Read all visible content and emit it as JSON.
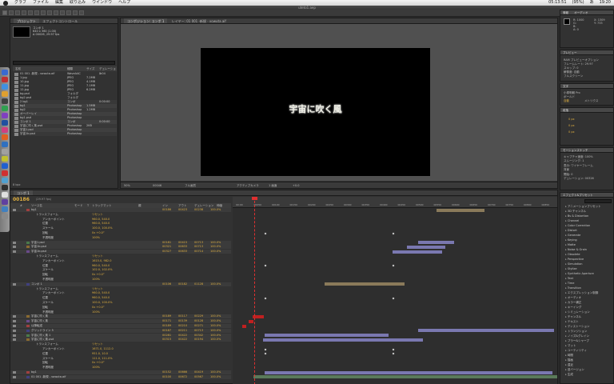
{
  "menubar": {
    "items": [
      "グラフ",
      "ファイル",
      "編集",
      "取り込み",
      "ウインドウ",
      "ヘルプ"
    ],
    "right": [
      "05:13:51",
      "(95%)",
      "あ",
      "19:20"
    ]
  },
  "window_title": "uteto1.aep",
  "toolbar": {
    "workspace": "ワークスペース"
  },
  "project_panel": {
    "tab": "プロジェクト",
    "tab2": "エフェクトコントロール",
    "thumb_info": [
      "コンポ 1",
      "640 x 360 (1.00)",
      "Δ 00026, 29.97 fps"
    ],
    "headers": [
      "名前",
      "種類",
      "サイズ",
      "デュレーション"
    ],
    "rows": [
      {
        "name": "01 001 -新規 - vowuta.aif",
        "type": "WaveAAC",
        "size": "",
        "dur": "0:04"
      },
      {
        "name": "1.jpg",
        "type": "JPEG",
        "size": "7.2MB",
        "dur": ""
      },
      {
        "name": "10.jpg",
        "type": "JPEG",
        "size": "4.1MB",
        "dur": ""
      },
      {
        "name": "11.jpg",
        "type": "JPEG",
        "size": "7.1MB",
        "dur": ""
      },
      {
        "name": "12.jpg",
        "type": "JPEG",
        "size": "6.2MB",
        "dur": ""
      },
      {
        "name": "bg.psd",
        "type": "フォルダ",
        "size": "",
        "dur": ""
      },
      {
        "name": "bg2.psd",
        "type": "フォルダ",
        "size": "",
        "dur": ""
      },
      {
        "name": "2 bg1",
        "type": "コンポ",
        "size": "",
        "dur": "0:00:00"
      },
      {
        "name": "bg1",
        "type": "Photoshop",
        "size": "1.5MB",
        "dur": ""
      },
      {
        "name": "bg2",
        "type": "Photoshop",
        "size": "1.2MB",
        "dur": ""
      },
      {
        "name": "オーバーレイ",
        "type": "Photoshop",
        "size": "",
        "dur": ""
      },
      {
        "name": "bg1.psd",
        "type": "Photoshop",
        "size": "",
        "dur": ""
      },
      {
        "name": "コンポ 1",
        "type": "コンポ",
        "size": "",
        "dur": "0:00:00"
      },
      {
        "name": "宇宙に吹く風.psd",
        "type": "Photoshop",
        "size": "2KB",
        "dur": ""
      },
      {
        "name": "宇宙1.psd",
        "type": "Photoshop",
        "size": "",
        "dur": ""
      },
      {
        "name": "宇宙1b.psd",
        "type": "Photoshop",
        "size": "",
        "dur": ""
      }
    ],
    "footer": "8 bpc"
  },
  "comp_panel": {
    "tabs": [
      "コンポジション: コンポ 1",
      "レイヤー: 01 001 -新規 - vowuta.aif"
    ],
    "title_text": "宇宙に吹く風",
    "bottom": [
      "50%",
      "00046",
      "フル画質",
      "アクティブカメラ",
      "1 画面",
      "+0.0"
    ]
  },
  "info_panel": {
    "tabs": [
      "情報",
      "オーディオ"
    ],
    "lines": [
      "R: 1000",
      "G:",
      "B:",
      "A: 0",
      "X: 1309",
      "Y: 733"
    ]
  },
  "preview_panel": {
    "header": "プレビュー",
    "lines": [
      "RAM プレビューオプション",
      "フレームレート: 29.97",
      "スキップ: 0",
      "解像度: 自動",
      "フルスクリーン"
    ]
  },
  "character_panel": {
    "header": "文字",
    "lines": [
      "小塚明朝 Pro",
      "ボールド",
      "自動",
      "メトリクス"
    ]
  },
  "paragraph_panel": {
    "header": "段落",
    "lines": [
      "0 px",
      "0 px",
      "0 px"
    ]
  },
  "motion_panel": {
    "header": "モーションスケッチ",
    "lines": [
      "キャプチャ速度: 100%",
      "スムージング: 1",
      "表示: ワイヤーフレーム",
      "背景",
      "開始: 0",
      "デュレーション: 00326"
    ]
  },
  "effects_panel": {
    "tab": "エフェクト&プリセット",
    "search": "",
    "items": [
      "アニメーションプリセット",
      "3D チャンネル",
      "Bs & Distortion",
      "Channel",
      "Color Correction",
      "Distort",
      "Generate",
      "Keying",
      "Matte",
      "Noise & Grain",
      "Obsolete",
      "Perspective",
      "Simulation",
      "Stylize",
      "Synthetic Aperture",
      "Text",
      "Time",
      "Transition",
      "エクスプレッション制御",
      "オーディオ",
      "カラー補正",
      "キーイング",
      "シミュレーション",
      "チャンネル",
      "テキスト",
      "ディストーション",
      "トランジション",
      "ノイズ&グレイン",
      "ブラー&シャープ",
      "マット",
      "ユーティリティ",
      "時間",
      "描画",
      "遠近",
      "旧バージョン",
      "生成"
    ]
  },
  "timeline": {
    "tab": "コンポ 1",
    "timecode": "00186",
    "timecode_sub": "(29.97 fps)",
    "headers": [
      "#",
      "ソース名",
      "モード",
      "T",
      "トラックマット",
      "親",
      "イン",
      "アウト",
      "デュレーション",
      "伸縮"
    ],
    "ruler_ticks": [
      "00:00",
      "00050",
      "00100",
      "00150",
      "00200",
      "00250",
      "00300",
      "00350",
      "00400",
      "00450",
      "00500",
      "00550",
      "00600",
      "00650",
      "00700",
      "00750",
      "00800",
      "00850"
    ],
    "rows": [
      {
        "num": "",
        "name": "bg1",
        "kind": "layer",
        "vals": [
          "",
          "00186",
          "00423",
          "00238",
          "100.0%"
        ]
      },
      {
        "num": "",
        "name": "トランスフォーム",
        "kind": "group",
        "vals": [
          "リセット"
        ]
      },
      {
        "num": "",
        "name": "アンカーポイント",
        "kind": "prop",
        "vals": [
          "960.0, 540.0"
        ]
      },
      {
        "num": "",
        "name": "位置",
        "kind": "prop",
        "vals": [
          "960.0, 540.0"
        ]
      },
      {
        "num": "",
        "name": "スケール",
        "kind": "prop",
        "vals": [
          "100.0, 100.0%"
        ]
      },
      {
        "num": "",
        "name": "回転",
        "kind": "prop",
        "vals": [
          "0x +0.0°"
        ]
      },
      {
        "num": "",
        "name": "不透明度",
        "kind": "prop",
        "vals": [
          "100%"
        ]
      },
      {
        "num": "",
        "name": "宇宙1.psd",
        "kind": "layer",
        "vals": [
          "00181",
          "00415",
          "00713",
          "100.0%"
        ]
      },
      {
        "num": "",
        "name": "宇宙1b.psd",
        "kind": "layer",
        "vals": [
          "00321",
          "00633",
          "00713",
          "100.0%"
        ]
      },
      {
        "num": "",
        "name": "宇宙1b.psd",
        "kind": "layer",
        "vals": [
          "00327",
          "00633",
          "00714",
          "100.0%"
        ]
      },
      {
        "num": "",
        "name": "トランスフォーム",
        "kind": "group",
        "vals": [
          "リセット"
        ]
      },
      {
        "num": "",
        "name": "アンカーポイント",
        "kind": "prop",
        "vals": [
          "1615.0, 982.0"
        ]
      },
      {
        "num": "",
        "name": "位置",
        "kind": "prop",
        "vals": [
          "960.0, 540.0"
        ]
      },
      {
        "num": "",
        "name": "スケール",
        "kind": "prop",
        "vals": [
          "102.0, 102.0%"
        ]
      },
      {
        "num": "",
        "name": "回転",
        "kind": "prop",
        "vals": [
          "0x +0.0°"
        ]
      },
      {
        "num": "",
        "name": "不透明度",
        "kind": "prop",
        "vals": [
          "100%"
        ]
      },
      {
        "num": "",
        "name": "コンポ 1",
        "kind": "layer",
        "vals": [
          "00106",
          "00182",
          "01128",
          "100.0%"
        ]
      },
      {
        "num": "",
        "name": "トランスフォーム",
        "kind": "group",
        "vals": [
          "リセット"
        ]
      },
      {
        "num": "",
        "name": "アンカーポイント",
        "kind": "prop",
        "vals": [
          "960.0, 540.0"
        ]
      },
      {
        "num": "",
        "name": "位置",
        "kind": "prop",
        "vals": [
          "960.0, 540.0"
        ]
      },
      {
        "num": "",
        "name": "スケール",
        "kind": "prop",
        "vals": [
          "100.0, 100.0%"
        ]
      },
      {
        "num": "",
        "name": "回転",
        "kind": "prop",
        "vals": [
          "0x +0.0°"
        ]
      },
      {
        "num": "",
        "name": "不透明度",
        "kind": "prop",
        "vals": [
          "100%"
        ]
      },
      {
        "num": "",
        "name": "宇宙に吹く風",
        "kind": "layer",
        "vals": [
          "00189",
          "00117",
          "00229",
          "100.0%"
        ]
      },
      {
        "num": "",
        "name": "宇宙に吹く風",
        "kind": "layer",
        "vals": [
          "00171",
          "00139",
          "00128",
          "100.0%"
        ]
      },
      {
        "num": "",
        "name": "以降転送",
        "kind": "layer",
        "vals": [
          "00189",
          "00210",
          "00271",
          "100.0%"
        ]
      },
      {
        "num": "",
        "name": "グリッドライン 5",
        "kind": "layer",
        "vals": [
          "00187",
          "00211",
          "00713",
          "100.0%"
        ]
      },
      {
        "num": "",
        "name": "宇宙に吹く風 1",
        "kind": "layer",
        "vals": [
          "00281",
          "00422",
          "00342",
          "100.0%"
        ]
      },
      {
        "num": "",
        "name": "宇宙に吹く風.psd",
        "kind": "layer",
        "vals": [
          "00315",
          "00422",
          "00194",
          "100.0%"
        ]
      },
      {
        "num": "",
        "name": "トランスフォーム",
        "kind": "group",
        "vals": [
          "リセット"
        ]
      },
      {
        "num": "",
        "name": "アンカーポイント",
        "kind": "prop",
        "vals": [
          "1671.0, 1112.0"
        ]
      },
      {
        "num": "",
        "name": "位置",
        "kind": "prop",
        "vals": [
          "951.0, 10.0"
        ]
      },
      {
        "num": "",
        "name": "スケール",
        "kind": "prop",
        "vals": [
          "111.0, 111.0%"
        ]
      },
      {
        "num": "",
        "name": "回転",
        "kind": "prop",
        "vals": [
          "0x +0.0°"
        ]
      },
      {
        "num": "",
        "name": "不透明度",
        "kind": "prop",
        "vals": [
          "100%"
        ]
      },
      {
        "num": "",
        "name": "bg1",
        "kind": "layer",
        "vals": [
          "00152",
          "00666",
          "00419",
          "100.0%"
        ]
      },
      {
        "num": "",
        "name": "01 001 -新規 - vowuta.aif",
        "kind": "layer",
        "vals": [
          "00100",
          "00672",
          "00567",
          "100.0%"
        ]
      }
    ]
  },
  "colors": {
    "accent_yellow": "#e0b040",
    "playhead": "#e03030",
    "bar_purple": "#7a78b0",
    "bar_tan": "#8a7a5a",
    "bar_red": "#c02020"
  }
}
